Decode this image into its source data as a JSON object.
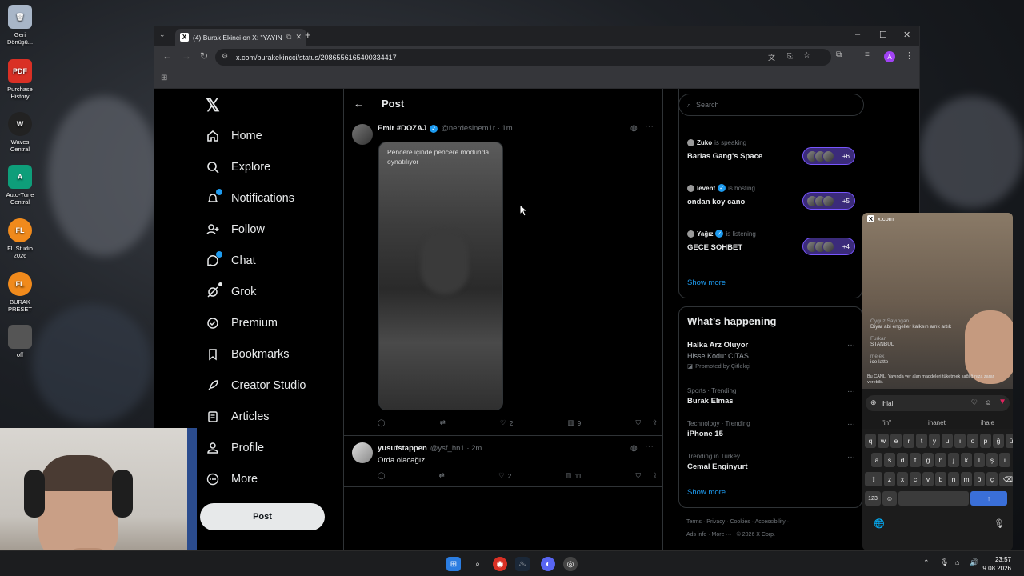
{
  "desktop": {
    "icons": [
      {
        "label": "Geri Dönüşü...",
        "icon": "recycle-bin-icon",
        "color": "#a8b6c8"
      },
      {
        "label": "Purchase History",
        "icon": "pdf-icon",
        "color": "#d93025",
        "glyph": "PDF"
      },
      {
        "label": "Waves Central",
        "icon": "waves-icon",
        "color": "#222222",
        "glyph": "W"
      },
      {
        "label": "Auto-Tune Central",
        "icon": "autotune-icon",
        "color": "#0e9e7a",
        "glyph": "A"
      },
      {
        "label": "FL Studio 2026",
        "icon": "fl-studio-icon",
        "color": "#f08a1c",
        "glyph": "FL"
      },
      {
        "label": "BURAK PRESET",
        "icon": "fl-studio-icon",
        "color": "#f08a1c",
        "glyph": "FL"
      },
      {
        "label": "off",
        "icon": "image-file-icon",
        "color": "#555555",
        "glyph": ""
      }
    ]
  },
  "browser": {
    "tab_title": "(4) Burak Ekinci on X: \"YAYIN",
    "url": "x.com/burakekincci/status/2086556165400334417"
  },
  "nav": {
    "items": [
      {
        "label": "Home",
        "icon": "home-icon"
      },
      {
        "label": "Explore",
        "icon": "search-icon"
      },
      {
        "label": "Notifications",
        "icon": "bell-icon"
      },
      {
        "label": "Follow",
        "icon": "follow-icon"
      },
      {
        "label": "Chat",
        "icon": "chat-icon"
      },
      {
        "label": "Grok",
        "icon": "grok-icon"
      },
      {
        "label": "Premium",
        "icon": "premium-icon"
      },
      {
        "label": "Bookmarks",
        "icon": "bookmark-icon"
      },
      {
        "label": "Creator Studio",
        "icon": "rocket-icon"
      },
      {
        "label": "Articles",
        "icon": "articles-icon"
      },
      {
        "label": "Profile",
        "icon": "profile-icon"
      },
      {
        "label": "More",
        "icon": "more-icon"
      }
    ],
    "post_button": "Post"
  },
  "main": {
    "title": "Post",
    "tweets": [
      {
        "name": "Emir #DOZAJ",
        "handle": "@nerdesinem1r · 1m",
        "media_caption": "Pencere içinde pencere modunda oynatılıyor",
        "likes": "2",
        "views": "9"
      },
      {
        "name": "yusufstappen",
        "handle": "@ysf_hn1 · 2m",
        "text": "Orda olacağız",
        "likes": "2",
        "views": "11"
      }
    ]
  },
  "right": {
    "search_placeholder": "Search",
    "spaces": [
      {
        "host": "Zuko",
        "role": "is speaking",
        "title": "Barlas Gang's Space",
        "count": "+6"
      },
      {
        "host": "levent",
        "role": "is hosting",
        "title": "ondan koy cano",
        "count": "+5"
      },
      {
        "host": "Yağız",
        "role": "is listening",
        "title": "GECE SOHBET",
        "count": "+4"
      }
    ],
    "spaces_show_more": "Show more",
    "happening_title": "What’s happening",
    "trends": [
      {
        "category": "",
        "title": "Halka Arz Oluyor",
        "sub": "Hisse Kodu: CITAS",
        "promo": "Promoted by Çitlekçi"
      },
      {
        "category": "Sports · Trending",
        "title": "Burak Elmas"
      },
      {
        "category": "Technology · Trending",
        "title": "iPhone 15"
      },
      {
        "category": "Trending in Turkey",
        "title": "Cemal Enginyurt"
      }
    ],
    "trends_show_more": "Show more",
    "footer": [
      "Terms",
      "Privacy",
      "Cookies",
      "Accessibility",
      "Ads info",
      "More ···",
      "© 2026 X Corp."
    ]
  },
  "phone": {
    "site": "x.com",
    "chat": [
      {
        "user": "Oyguz Sayıngan",
        "msg": "Diyar abi engeller kalksın amk artık"
      },
      {
        "user": "Furkan",
        "msg": "STANBUL"
      },
      {
        "user": "melek",
        "msg": "ice latte"
      }
    ],
    "warning": "Bu CANLI Yayında yer alan maddeleri tüketmek sağlığınıza zarar verebilir.",
    "input": "ihlal",
    "suggestions": [
      "\"ih\"",
      "ihanet",
      "ihale"
    ],
    "rows": [
      [
        "q",
        "w",
        "e",
        "r",
        "t",
        "y",
        "u",
        "ı",
        "o",
        "p",
        "ğ",
        "ü"
      ],
      [
        "a",
        "s",
        "d",
        "f",
        "g",
        "h",
        "j",
        "k",
        "l",
        "ş",
        "i"
      ],
      [
        "z",
        "x",
        "c",
        "v",
        "b",
        "n",
        "m",
        "ö",
        "ç"
      ]
    ],
    "num_key": "123"
  },
  "taskbar": {
    "time": "23:57",
    "date": "9.08.2026"
  }
}
